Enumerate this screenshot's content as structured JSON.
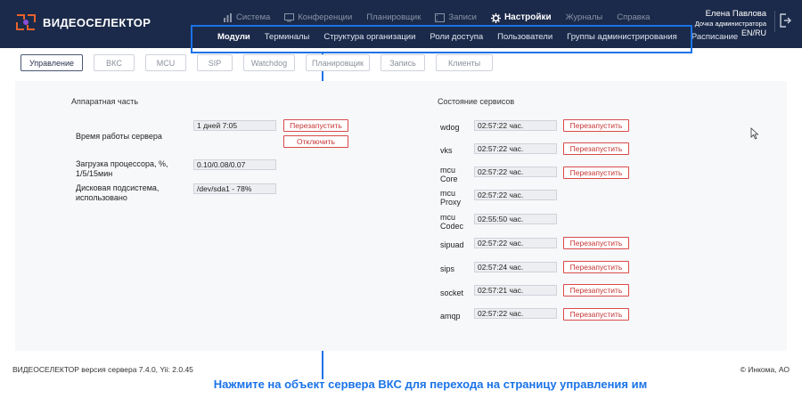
{
  "app": {
    "logo_text": "ВИДЕОСЕЛЕКТОР"
  },
  "main_nav": [
    {
      "label": "Система",
      "icon": "chart-icon"
    },
    {
      "label": "Конференции",
      "icon": "monitor-icon"
    },
    {
      "label": "Планировщик",
      "icon": ""
    },
    {
      "label": "Записи",
      "icon": "film-icon"
    },
    {
      "label": "Настройки",
      "icon": "gear-icon",
      "active": true
    },
    {
      "label": "Журналы",
      "icon": ""
    },
    {
      "label": "Справка",
      "icon": ""
    }
  ],
  "user": {
    "name": "Елена Павлова",
    "role": "Дочка администратора",
    "lang": "EN/RU"
  },
  "sub_nav": [
    {
      "label": "Модули",
      "active": true
    },
    {
      "label": "Терминалы"
    },
    {
      "label": "Структура организации"
    },
    {
      "label": "Роли доступа"
    },
    {
      "label": "Пользователи"
    },
    {
      "label": "Группы администрирования"
    },
    {
      "label": "Расписание"
    }
  ],
  "tabs": [
    "Управление",
    "ВКС",
    "MCU",
    "SIP",
    "Watchdog",
    "Планировщик",
    "Запись",
    "Клиенты"
  ],
  "hardware": {
    "title": "Аппаратная часть",
    "uptime_label": "Время работы сервера",
    "uptime_value": "1 дней 7:05",
    "restart_label": "Перезапустить",
    "disable_label": "Отключить",
    "cpu_label": "Загрузка процессора, %, 1/5/15мин",
    "cpu_value": "0.10/0.08/0.07",
    "disk_label": "Дисковая подсистема, использовано",
    "disk_value": "/dev/sda1 - 78%"
  },
  "services": {
    "title": "Состояние сервисов",
    "restart_label": "Перезапустить",
    "items": [
      {
        "name": "wdog",
        "value": "02:57:22 час.",
        "restart": true
      },
      {
        "name": "vks",
        "value": "02:57:22 час.",
        "restart": true
      },
      {
        "name": "mcu Core",
        "value": "02:57:22 час.",
        "restart": true
      },
      {
        "name": "mcu Proxy",
        "value": "02:57:22 час.",
        "restart": false
      },
      {
        "name": "mcu Codec",
        "value": "02:55:50 час.",
        "restart": false
      },
      {
        "name": "sipuad",
        "value": "02:57:22 час.",
        "restart": true
      },
      {
        "name": "sips",
        "value": "02:57:24 час.",
        "restart": true
      },
      {
        "name": "socket",
        "value": "02:57:21 час.",
        "restart": true
      },
      {
        "name": "amqp",
        "value": "02:57:22 час.",
        "restart": true
      }
    ]
  },
  "footer": {
    "left": "ВИДЕОСЕЛЕКТОР версия сервера 7.4.0, Yii: 2.0.45",
    "right": "© Инкома, АО"
  },
  "caption": "Нажмите на объект сервера ВКС для перехода на страницу управления им",
  "colors": {
    "header": "#1b2a4a",
    "accent": "#1a73e8",
    "danger": "#d94a4a"
  }
}
